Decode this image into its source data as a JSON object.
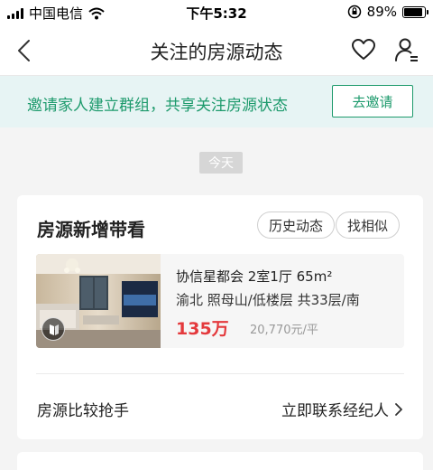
{
  "status": {
    "carrier": "中国电信",
    "time": "下午5:32",
    "battery": "89%",
    "battery_level": 0.89
  },
  "nav": {
    "title": "关注的房源动态",
    "icons": [
      "back-icon",
      "heart-icon",
      "user-list-icon"
    ]
  },
  "invite": {
    "text": "邀请家人建立群组，共享关注房源状态",
    "button": "去邀请"
  },
  "date_chip": "今天",
  "card": {
    "title": "房源新增带看",
    "actions": [
      "历史动态",
      "找相似"
    ],
    "listing": {
      "name": "协信星都会 2室1厅 65m²",
      "meta": "渝北 照母山/低楼层 共33层/南",
      "price": "135万",
      "unit_price": "20,770元/平"
    },
    "footer": {
      "left": "房源比较抢手",
      "right": "立即联系经纪人"
    }
  },
  "colors": {
    "accent": "#1d9a6c",
    "price": "#e4393c",
    "banner_bg": "#e7f4f4"
  }
}
